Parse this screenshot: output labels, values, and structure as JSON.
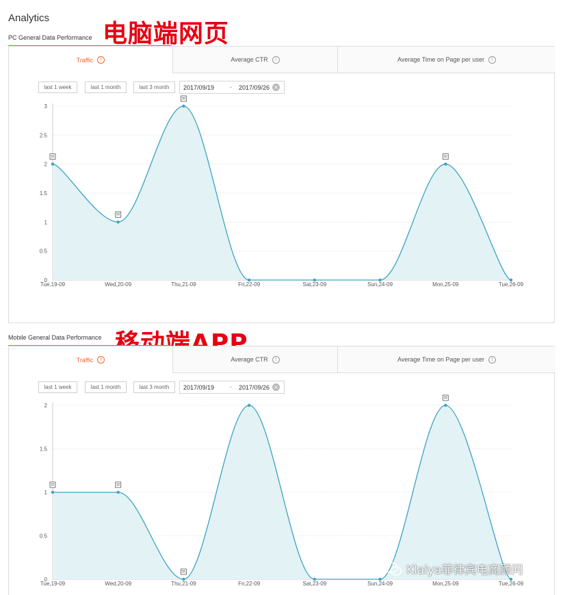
{
  "page": {
    "title": "Analytics"
  },
  "overlays": {
    "pc_label": "电脑端网页",
    "mobile_label": "移动端APP",
    "watermark": "Klaiya菲律宾电商顾问"
  },
  "pc_section": {
    "label": "PC General Data Performance",
    "tabs": [
      {
        "label": "Traffic",
        "active": true
      },
      {
        "label": "Average CTR",
        "active": false
      },
      {
        "label": "Average Time on Page per user",
        "active": false
      }
    ],
    "range_buttons": [
      "last 1 week",
      "last 1 month",
      "last 3 month"
    ],
    "date_start": "2017/09/19",
    "date_separator": "-",
    "date_end": "2017/09/26"
  },
  "mobile_section": {
    "label": "Mobile General Data Performance",
    "tabs": [
      {
        "label": "Traffic",
        "active": true
      },
      {
        "label": "Average CTR",
        "active": false
      },
      {
        "label": "Average Time on Page per user",
        "active": false
      }
    ],
    "range_buttons": [
      "last 1 week",
      "last 1 month",
      "last 3 month"
    ],
    "date_start": "2017/09/19",
    "date_separator": "-",
    "date_end": "2017/09/26"
  },
  "colors": {
    "accent": "#f0662a",
    "line": "#3aa2c4",
    "area": "#e3f2f5",
    "overlay_red": "#e60012"
  },
  "chart_data": [
    {
      "type": "area",
      "categories": [
        "Tue,19-09",
        "Wed,20-09",
        "Thu,21-09",
        "Fri,22-09",
        "Sat,23-09",
        "Sun,24-09",
        "Mon,25-09",
        "Tue,26-09"
      ],
      "series": [
        {
          "values": [
            2,
            1,
            3,
            0,
            0,
            0,
            2,
            0
          ]
        }
      ],
      "ylim": [
        0,
        3
      ],
      "yticks": [
        "0",
        "0.5",
        "1",
        "1.5",
        "2",
        "2.5",
        "3"
      ],
      "ytick_values": [
        0,
        0.5,
        1,
        1.5,
        2,
        2.5,
        3
      ],
      "annotated_points": [
        0,
        1,
        2,
        6
      ],
      "grid": true
    },
    {
      "type": "area",
      "categories": [
        "Tue,19-09",
        "Wed,20-09",
        "Thu,21-09",
        "Fri,22-09",
        "Sat,23-09",
        "Sun,24-09",
        "Mon,25-09",
        "Tue,26-09"
      ],
      "series": [
        {
          "values": [
            1,
            1,
            0,
            2,
            0,
            0,
            2,
            0
          ]
        }
      ],
      "ylim": [
        0,
        2
      ],
      "yticks": [
        "0",
        "0.5",
        "1",
        "1.5",
        "2"
      ],
      "ytick_values": [
        0,
        0.5,
        1,
        1.5,
        2
      ],
      "annotated_points": [
        0,
        1,
        2,
        6
      ],
      "grid": true
    }
  ]
}
